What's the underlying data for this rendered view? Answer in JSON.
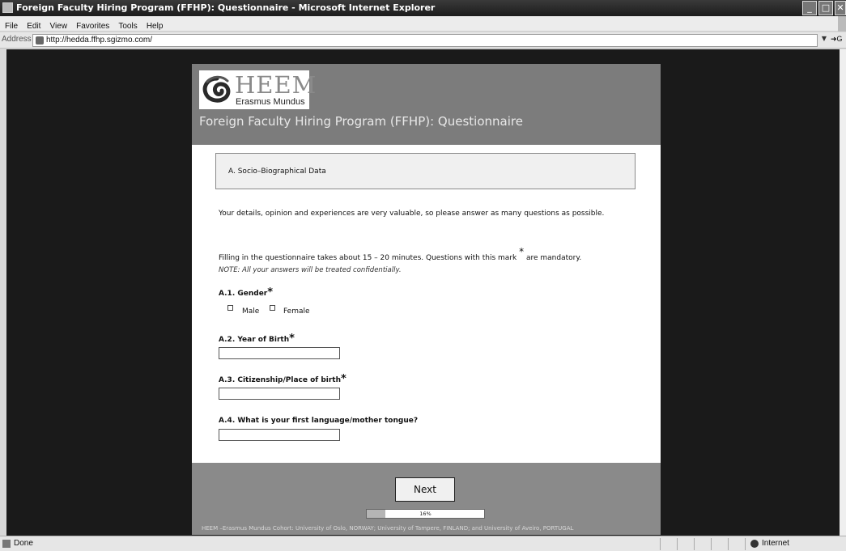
{
  "window": {
    "title": "Foreign Faculty Hiring Program (FFHP): Questionnaire - Microsoft Internet Explorer",
    "controls": {
      "minimize": "_",
      "maximize": "□",
      "close": "✕"
    }
  },
  "menu": {
    "items": [
      "File",
      "Edit",
      "View",
      "Favorites",
      "Tools",
      "Help"
    ]
  },
  "address": {
    "label": "Address",
    "url": "http://hedda.ffhp.sgizmo.com/",
    "dropdown_icon": "chevron-down-icon",
    "go_label": "G"
  },
  "survey": {
    "logo": {
      "main": "HEEM",
      "sub": "Erasmus Mundus"
    },
    "title": "Foreign Faculty Hiring Program (FFHP): Questionnaire",
    "section": "A. Socio–Biographical Data",
    "intro_1": "Your details, opinion and experiences are very valuable, so please answer as many questions as possible.",
    "intro_2_before": "Filling in the questionnaire takes about 15 – 20 minutes. Questions with this mark",
    "intro_2_mark": "*",
    "intro_2_after": "are mandatory.",
    "note": "NOTE: All your answers will be treated confidentially.",
    "questions": [
      {
        "label": "A.1. Gender",
        "required": "*",
        "type": "checkbox",
        "options": [
          "Male",
          "Female"
        ]
      },
      {
        "label": "A.2. Year of Birth",
        "required": "*",
        "type": "text",
        "value": ""
      },
      {
        "label": "A.3. Citizenship/Place of birth",
        "required": "*",
        "type": "text",
        "value": ""
      },
      {
        "label": "A.4. What is your first language/mother tongue?",
        "required": "",
        "type": "text",
        "value": ""
      }
    ],
    "next_button": "Next",
    "progress": {
      "percent": 16,
      "label": "16%"
    },
    "footer": "HEEM –Erasmus Mundus Cohort: University of Oslo, NORWAY; University of Tampere, FINLAND; and University of Aveiro, PORTUGAL"
  },
  "status": {
    "text": "Done",
    "zone": "Internet"
  }
}
